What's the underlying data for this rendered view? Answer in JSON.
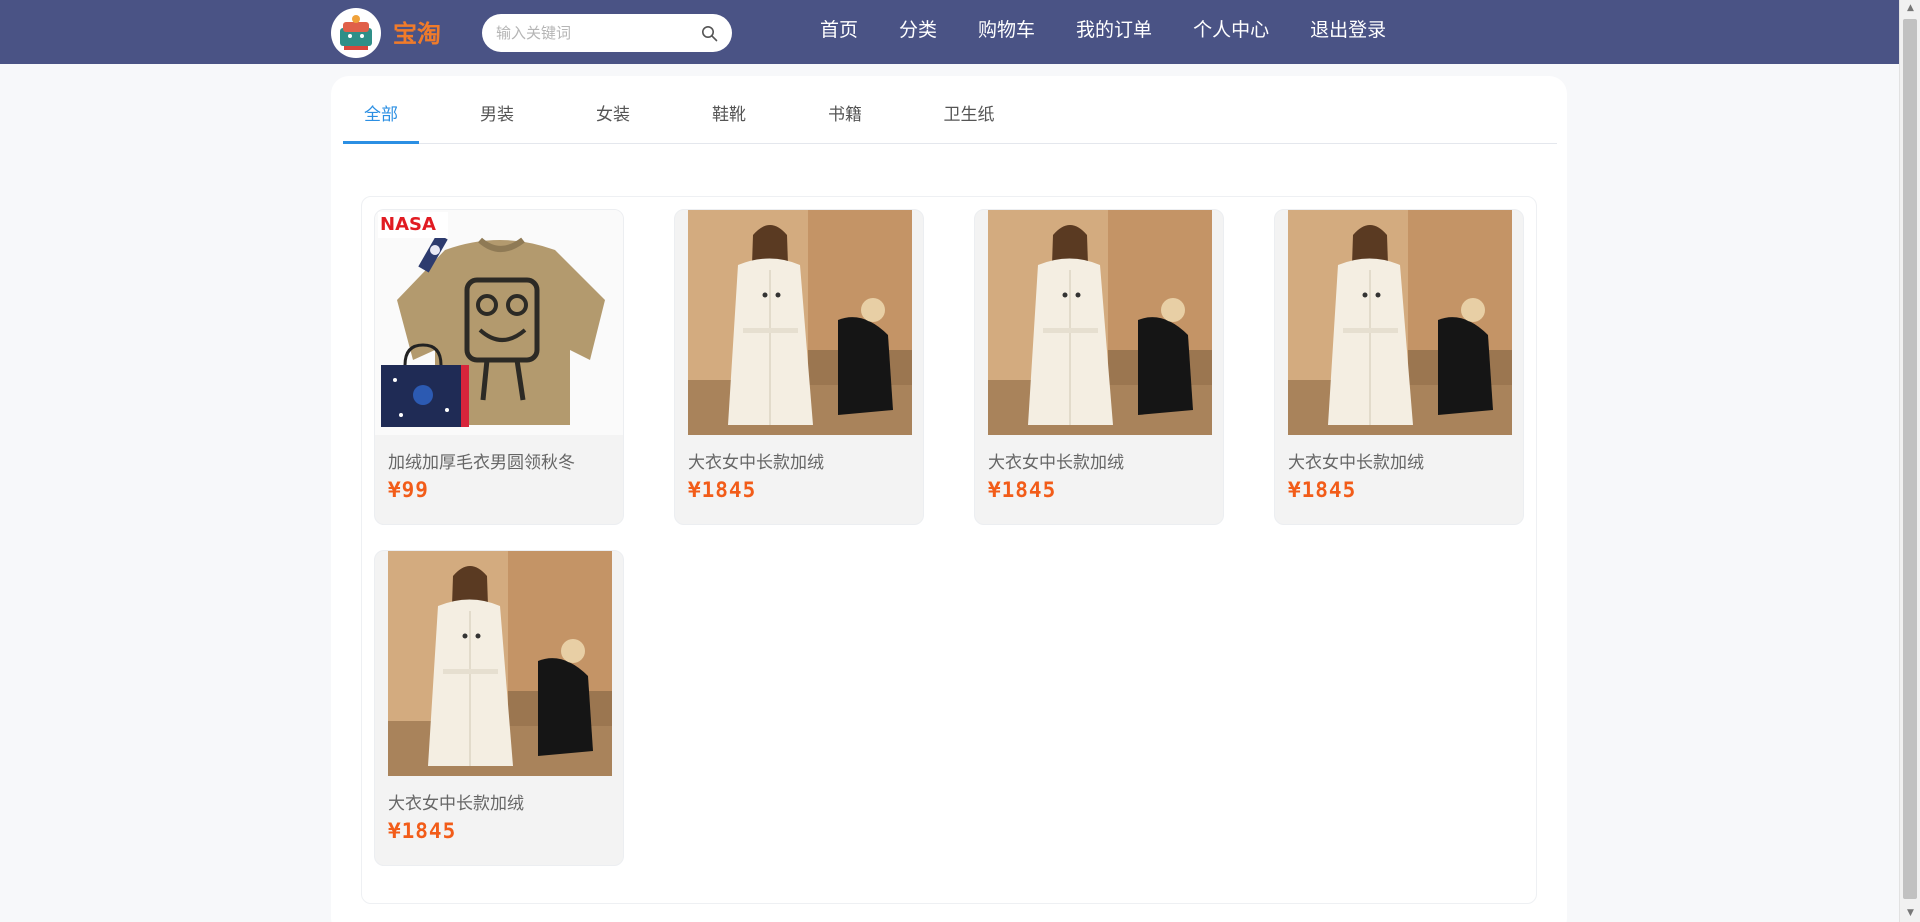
{
  "header": {
    "brand": "宝淘",
    "search": {
      "placeholder": "输入关键词",
      "value": ""
    },
    "nav": [
      "首页",
      "分类",
      "购物车",
      "我的订单",
      "个人中心",
      "退出登录"
    ]
  },
  "tabs": {
    "items": [
      "全部",
      "男装",
      "女装",
      "鞋靴",
      "书籍",
      "卫生纸"
    ],
    "active": "全部"
  },
  "products": [
    {
      "name": "加绒加厚毛衣男圆领秋冬",
      "price": "¥99",
      "image": "sweater"
    },
    {
      "name": "大衣女中长款加绒",
      "price": "¥1845",
      "image": "coat"
    },
    {
      "name": "大衣女中长款加绒",
      "price": "¥1845",
      "image": "coat"
    },
    {
      "name": "大衣女中长款加绒",
      "price": "¥1845",
      "image": "coat"
    },
    {
      "name": "大衣女中长款加绒",
      "price": "¥1845",
      "image": "coat"
    }
  ],
  "sweater_badge": "NASA",
  "colors": {
    "header_bg": "#4a5385",
    "brand": "#f07b2a",
    "accent": "#2b8fe3",
    "price": "#f25c19"
  }
}
